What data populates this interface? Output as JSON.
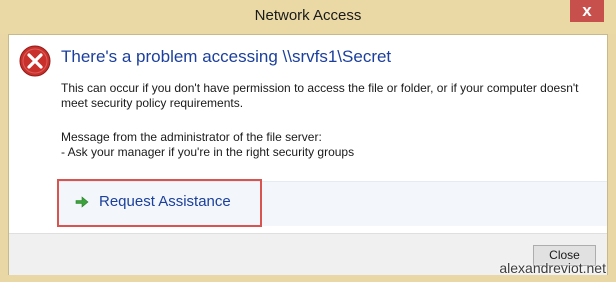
{
  "window": {
    "title": "Network Access",
    "close_glyph": "x"
  },
  "message": {
    "heading": "There's a problem accessing \\\\srvfs1\\Secret",
    "description": "This can occur if you don't have permission to access the file or folder, or if your computer doesn't meet security policy requirements.",
    "admin_intro": "Message from the administrator of the file server:",
    "admin_text": "- Ask your manager if you're in the right security groups"
  },
  "assist": {
    "label": "Request Assistance",
    "icon": "green-arrow-icon"
  },
  "footer": {
    "close_label": "Close"
  },
  "watermark": "alexandreviot.net",
  "colors": {
    "title_bar": "#ead9a5",
    "heading": "#1b3f9c",
    "highlight": "#d9534f",
    "error_icon": "#c9302c"
  }
}
